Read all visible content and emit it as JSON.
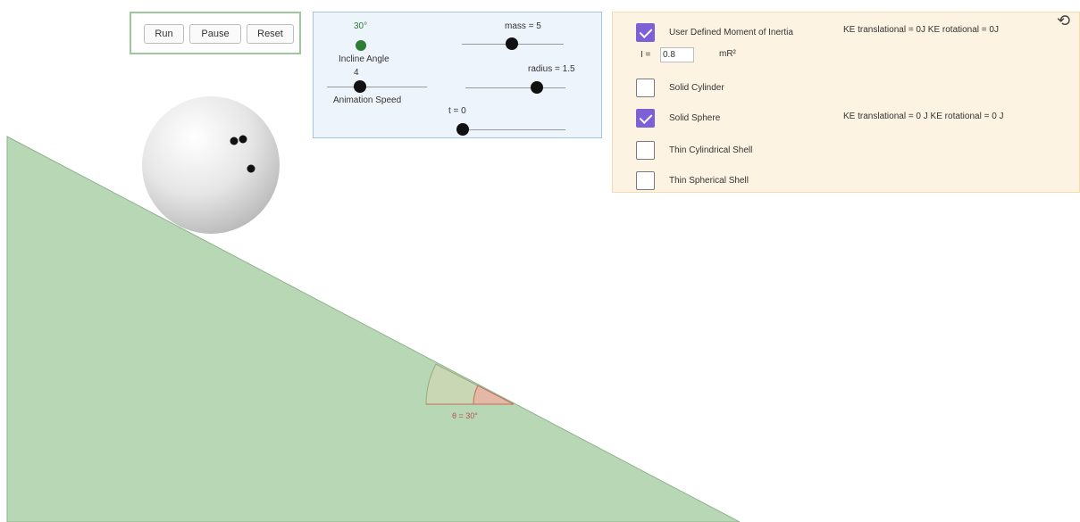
{
  "controls": {
    "run_label": "Run",
    "pause_label": "Pause",
    "reset_label": "Reset"
  },
  "sliders": {
    "angle_value_label": "30°",
    "angle_name": "Incline Angle",
    "speed_value_label": "4",
    "speed_name": "Animation Speed",
    "mass_label": "mass = 5",
    "radius_label": "radius = 1.5",
    "time_label": "t = 0"
  },
  "inertia": {
    "user_defined_label": "User Defined Moment of Inertia",
    "i_prefix": "I =",
    "i_value": "0.8",
    "i_unit": "mR²",
    "ke_user": "KE translational = 0J   KE rotational = 0J",
    "solid_cylinder_label": "Solid Cylinder",
    "solid_sphere_label": "Solid Sphere",
    "ke_sphere": "KE translational = 0 J   KE rotational = 0 J",
    "thin_cyl_label": "Thin Cylindrical Shell",
    "thin_sph_label": "Thin Spherical Shell",
    "checked": {
      "user_defined": true,
      "solid_cylinder": false,
      "solid_sphere": true,
      "thin_cyl": false,
      "thin_sph": false
    }
  },
  "scene": {
    "angle_label": "θ = 30°",
    "incline_color": "#b7d7b5",
    "angle_arc_color": "#c8d6b4",
    "angle_wedge_color": "#e8b8a8",
    "ball_color": "#e4e4e4"
  },
  "icons": {
    "reset": "circular-arrows-icon"
  }
}
